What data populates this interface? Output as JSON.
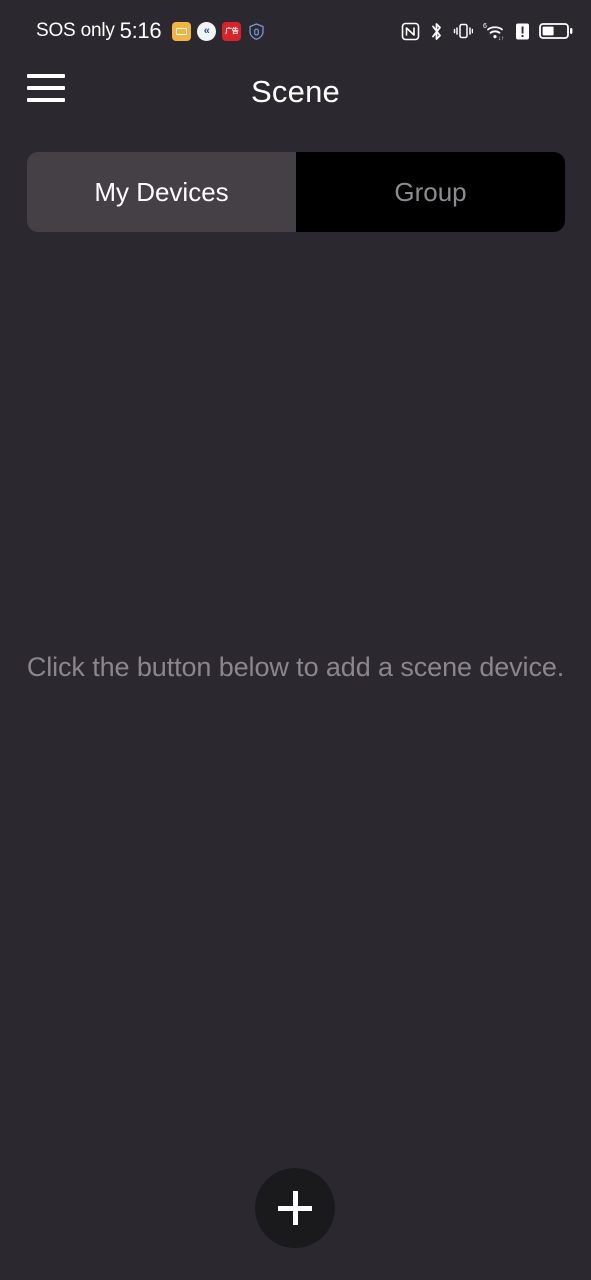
{
  "status_bar": {
    "carrier": "SOS only",
    "time": "5:16",
    "notification_icons": [
      {
        "name": "folder-notification-icon",
        "label": "",
        "color": "#f2b544"
      },
      {
        "name": "rewind-notification-icon",
        "label": "«",
        "color": "#f2f3f7"
      },
      {
        "name": "red-app-notification-icon",
        "label": "广告",
        "color": "#d8232a"
      },
      {
        "name": "shield-notification-icon",
        "label": "",
        "color": "#5b86c4"
      }
    ],
    "system_icons": [
      {
        "name": "nfc-icon"
      },
      {
        "name": "bluetooth-icon"
      },
      {
        "name": "vibrate-icon"
      },
      {
        "name": "wifi-icon",
        "badge": "6"
      },
      {
        "name": "alert-icon"
      },
      {
        "name": "battery-icon",
        "level": 45
      }
    ]
  },
  "header": {
    "menu_label": "Menu",
    "title": "Scene"
  },
  "tabs": [
    {
      "label": "My Devices",
      "active": true
    },
    {
      "label": "Group",
      "active": false
    }
  ],
  "main": {
    "empty_message": "Click the button below to add a scene device."
  },
  "fab": {
    "label": "+",
    "action": "Add scene device"
  },
  "colors": {
    "background": "#2c2830",
    "tab_active": "#453f46",
    "tab_inactive": "#000000",
    "fab": "#1a1a1c",
    "text_primary": "#ffffff",
    "text_muted": "#8a868c"
  }
}
